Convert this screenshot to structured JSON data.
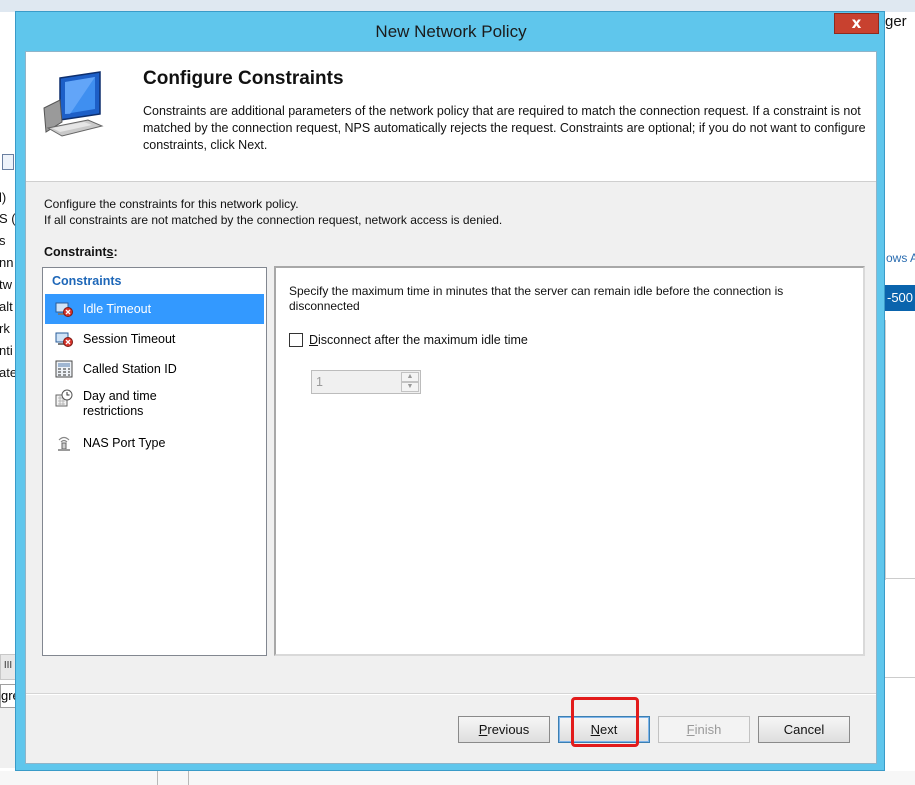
{
  "background": {
    "title_fragment": "ger",
    "tree_fragments": [
      "l)",
      "S (",
      "s",
      "nn",
      "tw",
      "alt",
      "rk",
      "nti",
      "ate"
    ],
    "scroll_fragment": "III",
    "input_fragment": "gre",
    "right_fragment_text": "ows A",
    "right_fragment_selected": "-500"
  },
  "dialog": {
    "title": "New Network Policy",
    "close_label": "x",
    "header": {
      "title": "Configure Constraints",
      "description": "Constraints are additional parameters of the network policy that are required to match the connection request. If a constraint is not matched by the connection request, NPS automatically rejects the request. Constraints are optional; if you do not want to configure constraints, click Next."
    },
    "intro_line1": "Configure the constraints for this network policy.",
    "intro_line2": "If all constraints are not matched by the connection request, network access is denied.",
    "constraints_label_pre": "Constraint",
    "constraints_label_acc": "s",
    "constraints_label_post": ":",
    "list": {
      "header": "Constraints",
      "items": [
        {
          "label": "Idle Timeout",
          "icon": "idle-timeout-icon"
        },
        {
          "label": "Session Timeout",
          "icon": "session-timeout-icon"
        },
        {
          "label": "Called Station ID",
          "icon": "called-station-icon"
        },
        {
          "label": "Day and time restrictions",
          "icon": "clock-calendar-icon"
        },
        {
          "label": "NAS Port Type",
          "icon": "nas-port-icon"
        }
      ],
      "selected_index": 0
    },
    "detail": {
      "description": "Specify the maximum time in minutes that the server can remain idle before the connection is disconnected",
      "checkbox_acc": "D",
      "checkbox_rest": "isconnect after the maximum idle time",
      "checkbox_checked": false,
      "spin_value": "1"
    },
    "buttons": {
      "previous_acc": "P",
      "previous_rest": "revious",
      "next_acc": "N",
      "next_rest": "ext",
      "finish_acc": "F",
      "finish_rest": "inish",
      "cancel": "Cancel"
    },
    "colors": {
      "frame": "#5fc6ec",
      "selection": "#3399ff",
      "annotation": "#e21b1b",
      "close": "#c8412f"
    }
  }
}
